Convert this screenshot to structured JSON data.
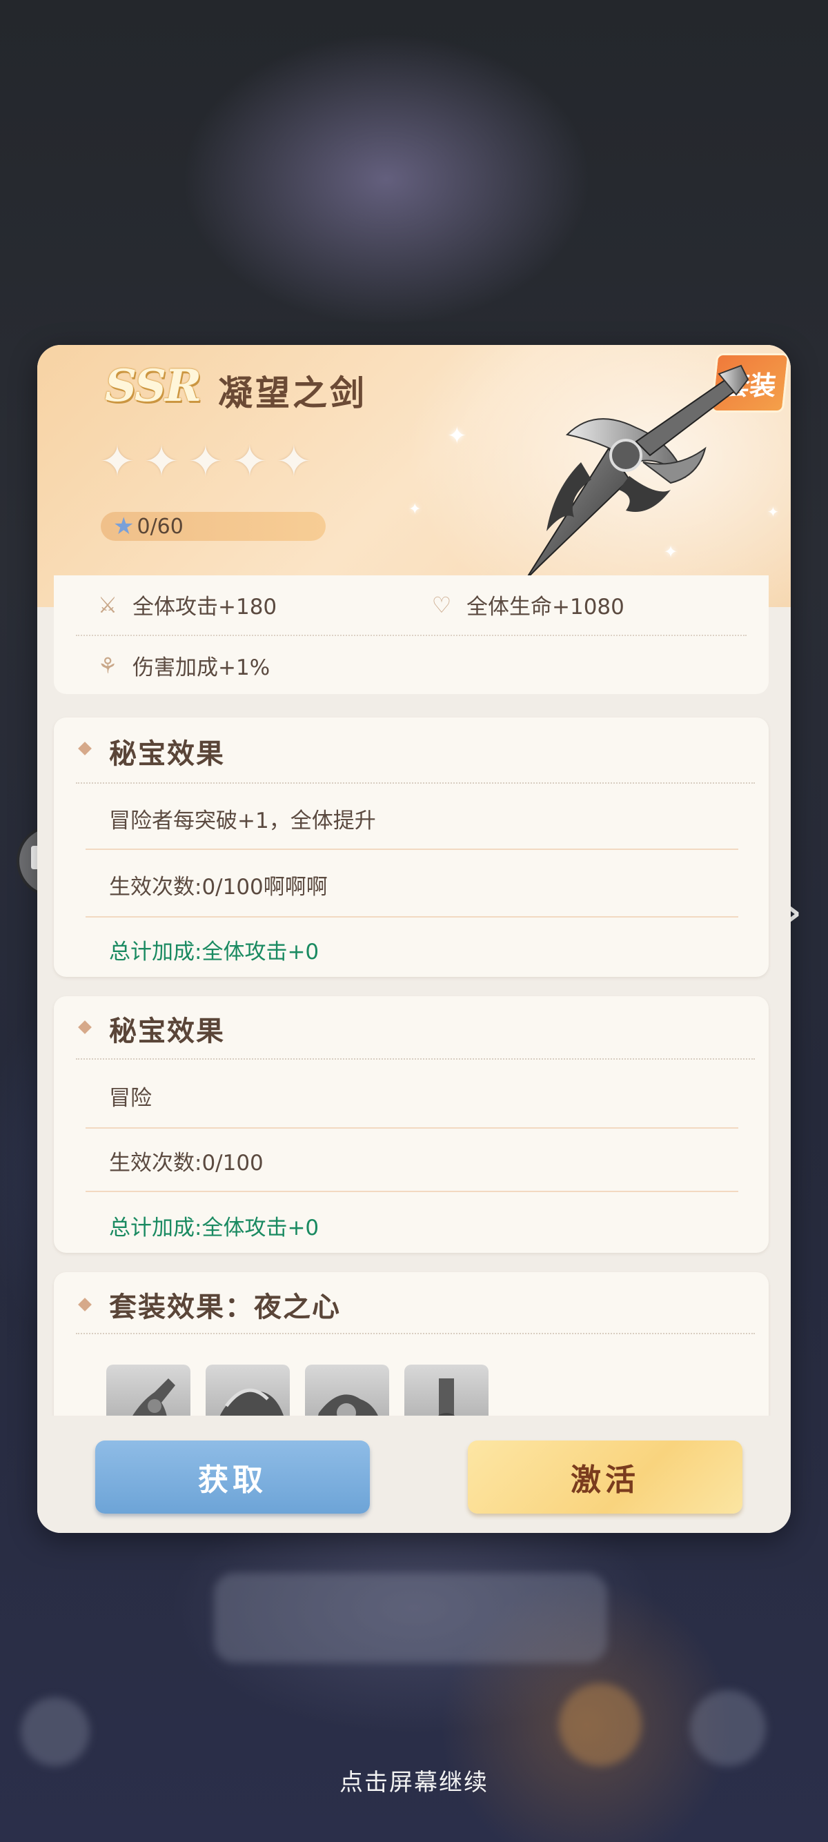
{
  "item": {
    "rarity": "SSR",
    "name": "凝望之剑",
    "stars_total": 5,
    "stars_filled": 0,
    "exp_text": "0/60",
    "set_badge": "套装"
  },
  "stats": [
    {
      "icon": "sword-stat-icon",
      "label": "全体攻击+180"
    },
    {
      "icon": "heart-stat-icon",
      "label": "全体生命+1080"
    },
    {
      "icon": "damage-stat-icon",
      "label": "伤害加成+1%"
    }
  ],
  "secret_effects": [
    {
      "title": "秘宝效果",
      "description": "冒险者每突破+1，全体提升",
      "count": "生效次数:0/100啊啊啊",
      "total": "总计加成:全体攻击+0"
    },
    {
      "title": "秘宝效果",
      "description": "冒险",
      "count": "生效次数:0/100",
      "total": "总计加成:全体攻击+0"
    }
  ],
  "set_effect": {
    "title": "套装效果：夜之心",
    "items": [
      "set-item-1",
      "set-item-2",
      "set-item-3",
      "set-item-4"
    ]
  },
  "buttons": {
    "obtain": "获取",
    "activate": "激活"
  },
  "footer": {
    "continue_hint": "点击屏幕继续"
  },
  "colors": {
    "accent_green": "#1a8a61",
    "obtain_button": "#7db0df",
    "activate_button": "#fbd98a"
  }
}
